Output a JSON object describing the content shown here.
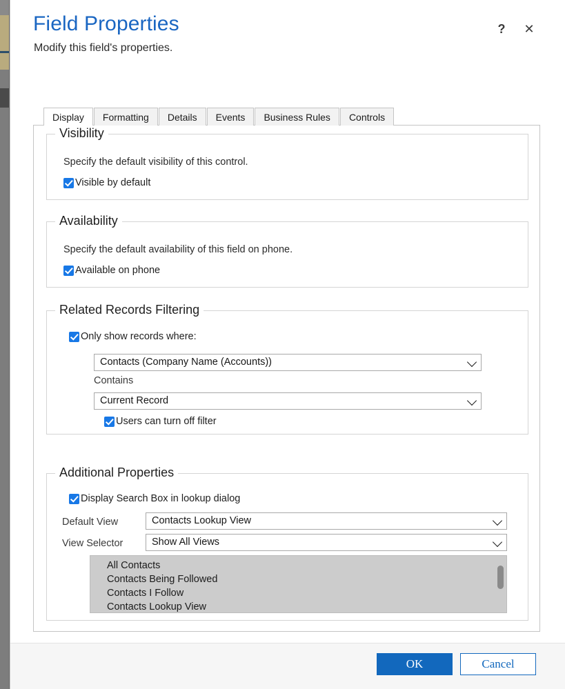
{
  "dialog": {
    "title": "Field Properties",
    "subtitle": "Modify this field's properties.",
    "help_label": "?",
    "close_label": "✕"
  },
  "tabs": [
    {
      "label": "Display",
      "active": true
    },
    {
      "label": "Formatting",
      "active": false
    },
    {
      "label": "Details",
      "active": false
    },
    {
      "label": "Events",
      "active": false
    },
    {
      "label": "Business Rules",
      "active": false
    },
    {
      "label": "Controls",
      "active": false
    }
  ],
  "visibility": {
    "legend": "Visibility",
    "hint": "Specify the default visibility of this control.",
    "checkbox_label": "Visible by default",
    "checked": true
  },
  "availability": {
    "legend": "Availability",
    "hint": "Specify the default availability of this field on phone.",
    "checkbox_label": "Available on phone",
    "checked": true
  },
  "related_records_filtering": {
    "legend": "Related Records Filtering",
    "only_show_label": "Only show records where:",
    "only_show_checked": true,
    "relationship_value": "Contacts (Company Name (Accounts))",
    "operator_label": "Contains",
    "target_value": "Current Record",
    "users_turn_off_label": "Users can turn off filter",
    "users_turn_off_checked": true
  },
  "additional_properties": {
    "legend": "Additional Properties",
    "search_box_label": "Display Search Box in lookup dialog",
    "search_box_checked": true,
    "default_view_label": "Default View",
    "default_view_value": "Contacts Lookup View",
    "view_selector_label": "View Selector",
    "view_selector_value": "Show All Views",
    "views": [
      "All Contacts",
      "Contacts Being Followed",
      "Contacts I Follow",
      "Contacts Lookup View"
    ]
  },
  "footer": {
    "ok_label": "OK",
    "cancel_label": "Cancel"
  },
  "colors": {
    "title_blue": "#1a66c2",
    "accent_blue": "#1268bd",
    "checkbox_blue": "#1878e6",
    "listbox_grey": "#cccccc",
    "footer_grey": "#f6f6f6"
  }
}
